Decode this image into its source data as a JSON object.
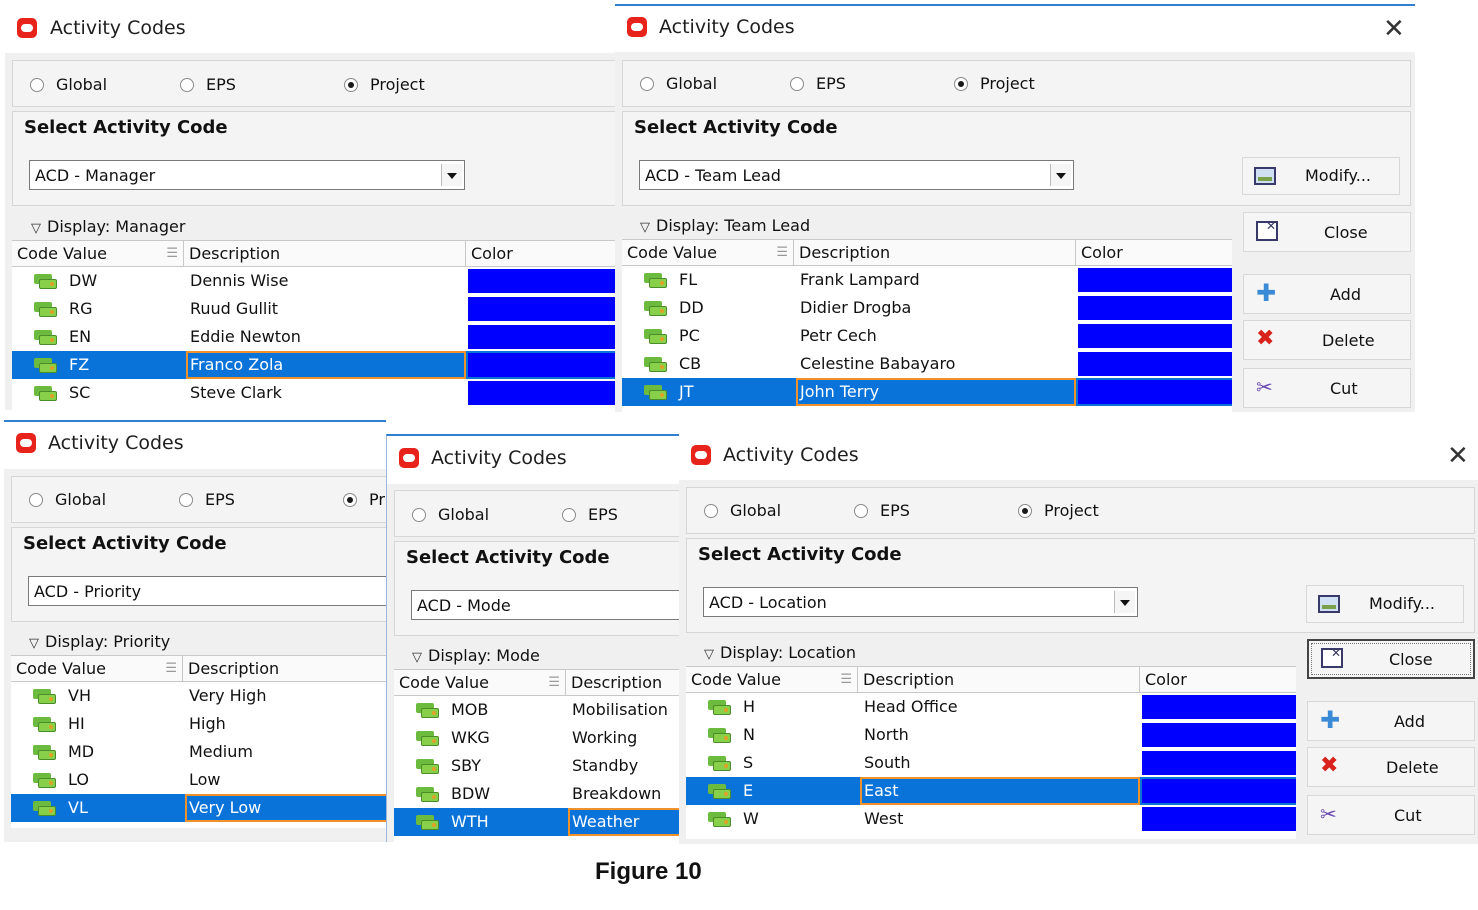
{
  "caption": "Figure 10",
  "windows": [
    {
      "title": "Activity Codes",
      "radios": {
        "global": "Global",
        "eps": "EPS",
        "project": "Project",
        "selected": "project"
      },
      "select_label": "Select Activity Code",
      "combo_value": "ACD - Manager",
      "display_label": "Display: Manager",
      "columns": {
        "code": "Code Value",
        "description": "Description",
        "color": "Color"
      },
      "rows": [
        {
          "code": "DW",
          "description": "Dennis Wise",
          "color": "#0000ff"
        },
        {
          "code": "RG",
          "description": "Ruud Gullit",
          "color": "#0000ff"
        },
        {
          "code": "EN",
          "description": "Eddie Newton",
          "color": "#0000ff"
        },
        {
          "code": "FZ",
          "description": "Franco Zola",
          "color": "#0000ff",
          "selected": true
        },
        {
          "code": "SC",
          "description": "Steve Clark",
          "color": "#0000ff"
        }
      ]
    },
    {
      "title": "Activity Codes",
      "close_glyph": "✕",
      "radios": {
        "global": "Global",
        "eps": "EPS",
        "project": "Project",
        "selected": "project"
      },
      "select_label": "Select Activity Code",
      "combo_value": "ACD - Team Lead",
      "display_label": "Display: Team Lead",
      "columns": {
        "code": "Code Value",
        "description": "Description",
        "color": "Color"
      },
      "rows": [
        {
          "code": "FL",
          "description": "Frank Lampard",
          "color": "#0000ff"
        },
        {
          "code": "DD",
          "description": "Didier Drogba",
          "color": "#0000ff"
        },
        {
          "code": "PC",
          "description": "Petr Cech",
          "color": "#0000ff"
        },
        {
          "code": "CB",
          "description": "Celestine Babayaro",
          "color": "#0000ff"
        },
        {
          "code": "JT",
          "description": "John Terry",
          "color": "#0000ff",
          "selected": true
        }
      ],
      "buttons": {
        "modify": "Modify...",
        "close": "Close",
        "add": "Add",
        "delete": "Delete",
        "cut": "Cut"
      }
    },
    {
      "title": "Activity Codes",
      "radios": {
        "global": "Global",
        "eps": "EPS",
        "project": "Pr",
        "selected": "project"
      },
      "select_label": "Select Activity Code",
      "combo_value": "ACD - Priority",
      "display_label": "Display: Priority",
      "columns": {
        "code": "Code Value",
        "description": "Description"
      },
      "rows": [
        {
          "code": "VH",
          "description": "Very High"
        },
        {
          "code": "HI",
          "description": "High"
        },
        {
          "code": "MD",
          "description": "Medium"
        },
        {
          "code": "LO",
          "description": "Low"
        },
        {
          "code": "VL",
          "description": "Very Low",
          "selected": true
        }
      ]
    },
    {
      "title": "Activity Codes",
      "radios": {
        "global": "Global",
        "eps": "EPS"
      },
      "select_label": "Select Activity Code",
      "combo_value": "ACD - Mode",
      "display_label": "Display: Mode",
      "columns": {
        "code": "Code Value",
        "description": "Description"
      },
      "rows": [
        {
          "code": "MOB",
          "description": "Mobilisation"
        },
        {
          "code": "WKG",
          "description": "Working"
        },
        {
          "code": "SBY",
          "description": "Standby"
        },
        {
          "code": "BDW",
          "description": "Breakdown"
        },
        {
          "code": "WTH",
          "description": "Weather",
          "selected": true
        }
      ]
    },
    {
      "title": "Activity Codes",
      "close_glyph": "✕",
      "radios": {
        "global": "Global",
        "eps": "EPS",
        "project": "Project",
        "selected": "project"
      },
      "select_label": "Select Activity Code",
      "combo_value": "ACD - Location",
      "display_label": "Display: Location",
      "columns": {
        "code": "Code Value",
        "description": "Description",
        "color": "Color"
      },
      "rows": [
        {
          "code": "H",
          "description": "Head Office",
          "color": "#0000ff"
        },
        {
          "code": "N",
          "description": "North",
          "color": "#0000ff"
        },
        {
          "code": "S",
          "description": "South",
          "color": "#0000ff"
        },
        {
          "code": "E",
          "description": "East",
          "color": "#0000ff",
          "selected": true
        },
        {
          "code": "W",
          "description": "West",
          "color": "#0000ff"
        }
      ],
      "buttons": {
        "modify": "Modify...",
        "close": "Close",
        "add": "Add",
        "delete": "Delete",
        "cut": "Cut"
      }
    }
  ],
  "icons": {
    "app": "oracle-logo-icon",
    "row": "activity-code-tag-icon",
    "modify": "modify-icon",
    "close": "close-window-icon",
    "add": "add-plus-icon",
    "delete": "delete-x-icon",
    "cut": "scissors-icon",
    "sort": "sort-icon",
    "dropdown": "dropdown-arrow-icon"
  },
  "colors": {
    "selection": "#0a73da",
    "selection_border": "#f0922b",
    "code_color": "#0000ff",
    "brand": "#e8231b"
  }
}
